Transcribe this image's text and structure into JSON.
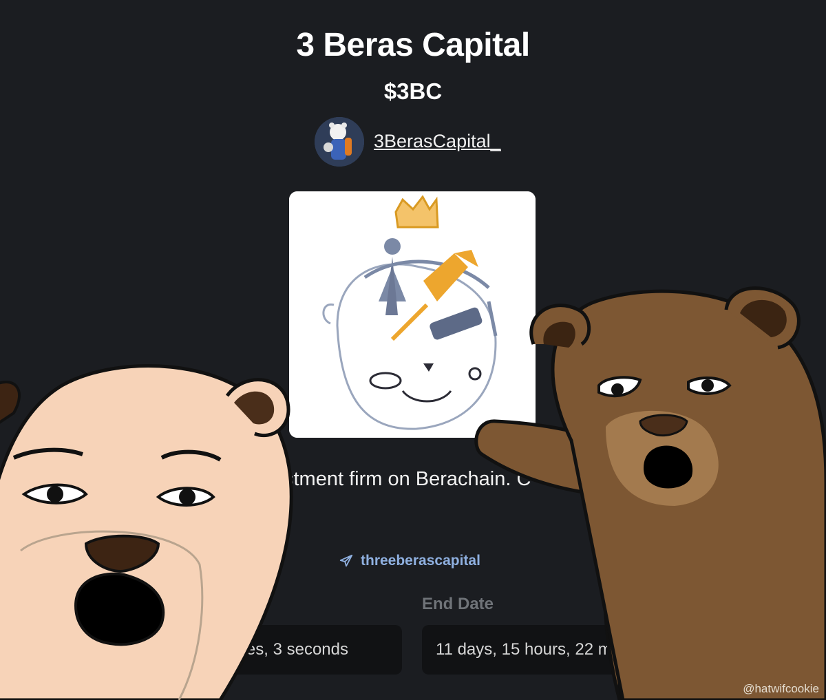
{
  "token": {
    "name": "3 Beras Capital",
    "ticker": "$3BC",
    "creator_handle": "3BerasCapital_",
    "description_visible": "stment firm on Berachain. C",
    "social": {
      "label": "threeberascapital",
      "icon": "telegram-icon"
    }
  },
  "timers": {
    "end_date_label": "End Date",
    "left_value": "nutes, 3 seconds",
    "right_value": "11 days, 15 hours, 22 minut"
  },
  "watermark": "@hatwifcookie",
  "colors": {
    "background": "#1b1d21",
    "link": "#8fb0e0",
    "crown": "#e8a92c",
    "light_bear": "#f7d3b8",
    "dark_bear": "#7d5733"
  }
}
